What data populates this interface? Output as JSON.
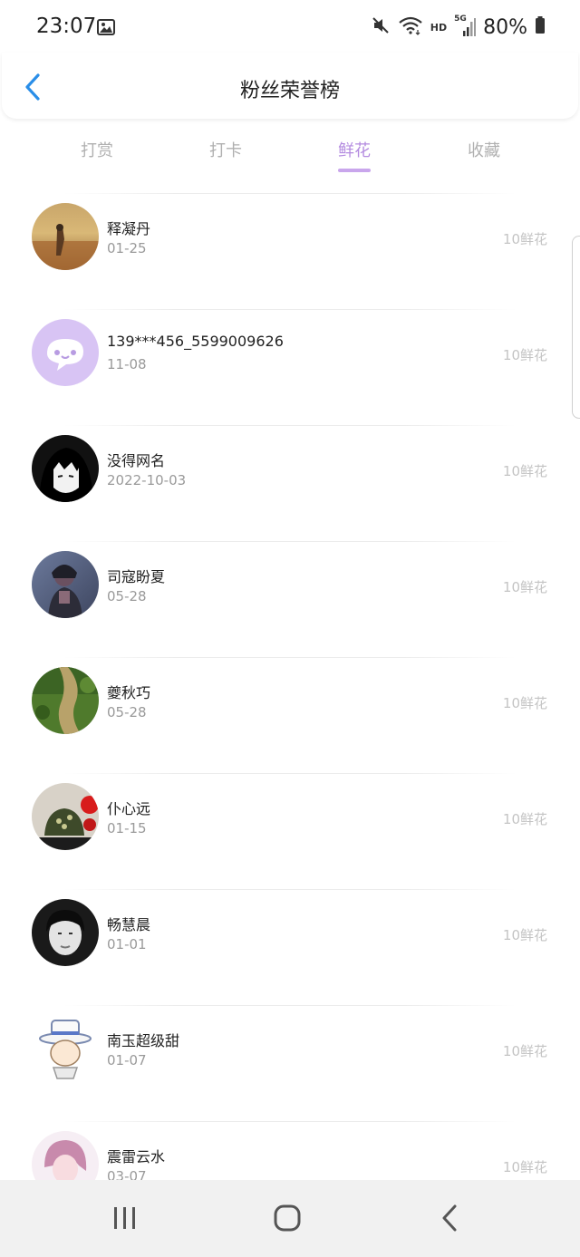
{
  "status_bar": {
    "time": "23:07",
    "hd": "HD",
    "network": "5G",
    "battery": "80%",
    "icons": [
      "gallery-icon",
      "mute-icon",
      "wifi-icon",
      "signal-icon",
      "battery-icon"
    ]
  },
  "header": {
    "title": "粉丝荣誉榜",
    "back_icon": "chevron-left-icon"
  },
  "tabs": [
    {
      "label": "打赏",
      "active": false
    },
    {
      "label": "打卡",
      "active": false
    },
    {
      "label": "鲜花",
      "active": true
    },
    {
      "label": "收藏",
      "active": false
    }
  ],
  "list": [
    {
      "name": "释凝丹",
      "date": "01-25",
      "amount": "10鲜花"
    },
    {
      "name": "139***456_5599009626",
      "date": "11-08",
      "amount": "10鲜花"
    },
    {
      "name": "没得网名",
      "date": "2022-10-03",
      "amount": "10鲜花"
    },
    {
      "name": "司寇盼夏",
      "date": "05-28",
      "amount": "10鲜花"
    },
    {
      "name": "夔秋巧",
      "date": "05-28",
      "amount": "10鲜花"
    },
    {
      "name": "仆心远",
      "date": "01-15",
      "amount": "10鲜花"
    },
    {
      "name": "畅慧晨",
      "date": "01-01",
      "amount": "10鲜花"
    },
    {
      "name": "南玉超级甜",
      "date": "01-07",
      "amount": "10鲜花"
    },
    {
      "name": "震雷云水",
      "date": "03-07",
      "amount": "10鲜花"
    }
  ],
  "colors": {
    "accent": "#b48ce0",
    "back_arrow": "#2a8ee8",
    "inactive_tab": "#b0b0b0",
    "amount": "#c4c4c4"
  },
  "nav": [
    "recent-apps-icon",
    "home-icon",
    "back-icon"
  ]
}
